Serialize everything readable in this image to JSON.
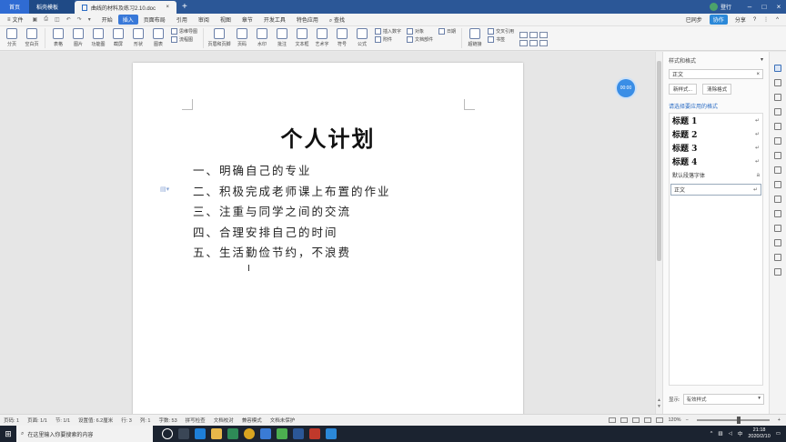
{
  "titlebar": {
    "tabs": [
      {
        "label": "首页"
      },
      {
        "label": "稻壳模板"
      },
      {
        "label": "曲线的材料及练习2.10.doc"
      }
    ],
    "add_tab": "+",
    "login_label": "登行"
  },
  "menubar": {
    "file_label": "文件",
    "items": [
      "开始",
      "插入",
      "页面布局",
      "引用",
      "审阅",
      "视图",
      "章节",
      "开发工具",
      "特色应用"
    ],
    "active": "插入",
    "search": "查找",
    "sync_label": "已同步",
    "collab_label": "协作",
    "share_label": "分享"
  },
  "ribbon": {
    "buttons": [
      "分页",
      "空白页",
      "表格",
      "图片",
      "功能图",
      "截屏",
      "形状",
      "图表"
    ],
    "small_group_1": [
      "思维导图",
      "流程图"
    ],
    "buttons_2": [
      "页眉和页脚",
      "页码",
      "水印",
      "批注",
      "文本框",
      "艺术字",
      "符号",
      "公式"
    ],
    "small_group_2": [
      "插入数字",
      "附件"
    ],
    "small_group_3": [
      "对象",
      "文档部件"
    ],
    "small_group_4": [
      "日期"
    ],
    "buttons_3": [
      "超链接"
    ],
    "small_group_5": [
      "交叉引用",
      "书签"
    ]
  },
  "document": {
    "title": "个人计划",
    "lines": [
      "一、明确自己的专业",
      "二、积极完成老师课上布置的作业",
      "三、注重与同学之间的交流",
      "四、合理安排自己的时间",
      "五、生活勤俭节约，不浪费"
    ],
    "timer": "00:00"
  },
  "styles_panel": {
    "title": "样式和格式",
    "current_style": "正文",
    "new_style_button": "新样式...",
    "clear_format_button": "清除格式",
    "subtitle": "请选择要应用的格式",
    "styles": [
      {
        "name": "标题 1",
        "mark": "↵"
      },
      {
        "name": "标题 2",
        "mark": "↵"
      },
      {
        "name": "标题 3",
        "mark": "↵"
      },
      {
        "name": "标题 4",
        "mark": "↵"
      },
      {
        "name": "默认段落字体",
        "mark": "a"
      },
      {
        "name": "正文",
        "mark": "↵"
      }
    ],
    "footer_label": "显示:",
    "footer_value": "有效样式"
  },
  "statusbar": {
    "items": [
      "页码: 1",
      "页面: 1/1",
      "节: 1/1",
      "设置值: 6.2厘米",
      "行: 3",
      "列: 1",
      "字数: 53",
      "拼写检查",
      "文档校对",
      "兼容模式",
      "文档未保护"
    ],
    "zoom": "120%"
  },
  "taskbar": {
    "search_placeholder": "在这里输入你要搜索的内容",
    "time": "21:18",
    "date": "2020/2/10"
  }
}
